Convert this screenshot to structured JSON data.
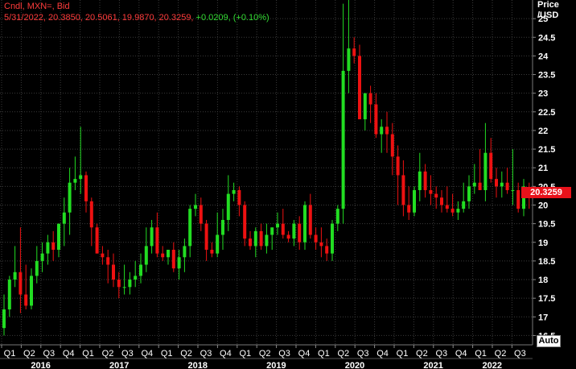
{
  "header": {
    "line1": "Cndl, MXN=, Bid",
    "line2_prefix": "5/31/2022, 20.3850, 20.5061, 19.9870, 20.3259, ",
    "line2_change": "+0.0209, (+0.10%)"
  },
  "axis": {
    "title_line1": "Price",
    "title_line2": "/USD",
    "auto_label": "Auto",
    "last_price": "20.3259"
  },
  "colors": {
    "up": "#22dd22",
    "down": "#ee1111",
    "background": "#000000",
    "grid": "#3a3a3a",
    "text": "#ffffff",
    "last_price_tag": "#e8121b"
  },
  "chart_data": {
    "type": "candlestick",
    "title": "Cndl, MXN=, Bid",
    "ylabel": "Price /USD",
    "ylim": [
      16.25,
      25.5
    ],
    "y_ticks": [
      "16.5",
      "17",
      "17.5",
      "18",
      "18.5",
      "19",
      "19.5",
      "20",
      "20.5",
      "21",
      "21.5",
      "22",
      "22.5",
      "23",
      "23.5",
      "24",
      "24.5",
      "25"
    ],
    "x_quarter_labels": [
      "Q1",
      "Q2",
      "Q3",
      "Q4",
      "Q1",
      "Q2",
      "Q3",
      "Q4",
      "Q1",
      "Q2",
      "Q3",
      "Q4",
      "Q1",
      "Q2",
      "Q3",
      "Q4",
      "Q1",
      "Q2",
      "Q3",
      "Q4",
      "Q1",
      "Q2",
      "Q3",
      "Q4",
      "Q1",
      "Q2",
      "Q3"
    ],
    "x_year_labels": [
      {
        "year": "2016",
        "quarter_index": 1.5
      },
      {
        "year": "2017",
        "quarter_index": 5.5
      },
      {
        "year": "2018",
        "quarter_index": 9.5
      },
      {
        "year": "2019",
        "quarter_index": 13.5
      },
      {
        "year": "2020",
        "quarter_index": 17.5
      },
      {
        "year": "2021",
        "quarter_index": 21.5
      },
      {
        "year": "2022",
        "quarter_index": 24.5
      }
    ],
    "series": {
      "name": "MXN= Bid (monthly OHLC)",
      "ohlc": [
        [
          16.7,
          17.6,
          16.5,
          17.2
        ],
        [
          17.2,
          18.1,
          17.0,
          18.0
        ],
        [
          18.0,
          18.9,
          17.8,
          18.2
        ],
        [
          18.2,
          19.4,
          17.1,
          17.6
        ],
        [
          17.6,
          18.4,
          17.2,
          17.3
        ],
        [
          17.3,
          18.3,
          17.2,
          18.1
        ],
        [
          18.1,
          18.9,
          17.9,
          18.5
        ],
        [
          18.5,
          19.0,
          18.2,
          18.7
        ],
        [
          18.7,
          19.2,
          18.4,
          19.0
        ],
        [
          19.0,
          19.3,
          18.5,
          18.8
        ],
        [
          18.8,
          19.5,
          18.6,
          19.5
        ],
        [
          19.5,
          20.2,
          18.9,
          19.8
        ],
        [
          19.8,
          21.0,
          19.2,
          20.6
        ],
        [
          20.6,
          21.3,
          20.4,
          20.7
        ],
        [
          20.7,
          22.1,
          20.3,
          20.8
        ],
        [
          20.8,
          20.9,
          19.8,
          20.1
        ],
        [
          20.1,
          20.2,
          18.9,
          19.4
        ],
        [
          19.4,
          19.5,
          18.7,
          18.7
        ],
        [
          18.7,
          18.9,
          18.4,
          18.6
        ],
        [
          18.6,
          18.8,
          17.9,
          18.4
        ],
        [
          18.4,
          18.7,
          17.8,
          18.0
        ],
        [
          18.0,
          18.2,
          17.5,
          17.8
        ],
        [
          17.8,
          18.4,
          17.6,
          17.8
        ],
        [
          17.8,
          18.2,
          17.6,
          18.0
        ],
        [
          18.0,
          18.5,
          17.8,
          18.1
        ],
        [
          18.1,
          18.7,
          17.9,
          18.4
        ],
        [
          18.4,
          19.4,
          18.2,
          18.9
        ],
        [
          18.9,
          19.6,
          18.7,
          19.4
        ],
        [
          19.4,
          19.8,
          18.6,
          18.7
        ],
        [
          18.7,
          18.9,
          18.5,
          18.6
        ],
        [
          18.6,
          18.8,
          18.4,
          18.8
        ],
        [
          18.8,
          19.0,
          18.2,
          18.3
        ],
        [
          18.3,
          18.8,
          18.0,
          18.6
        ],
        [
          18.6,
          19.1,
          18.2,
          18.9
        ],
        [
          18.9,
          20.0,
          18.6,
          19.9
        ],
        [
          19.9,
          20.3,
          19.7,
          20.0
        ],
        [
          20.0,
          20.2,
          19.3,
          19.5
        ],
        [
          19.5,
          19.6,
          18.5,
          18.8
        ],
        [
          18.8,
          19.0,
          18.6,
          18.7
        ],
        [
          18.7,
          19.8,
          18.6,
          19.2
        ],
        [
          19.2,
          19.9,
          18.8,
          19.6
        ],
        [
          19.6,
          20.8,
          19.3,
          20.3
        ],
        [
          20.3,
          20.6,
          20.1,
          20.4
        ],
        [
          20.4,
          20.5,
          19.7,
          20.0
        ],
        [
          20.0,
          20.1,
          18.9,
          19.1
        ],
        [
          19.1,
          19.3,
          18.8,
          18.9
        ],
        [
          18.9,
          19.4,
          18.6,
          19.3
        ],
        [
          19.3,
          19.5,
          18.8,
          18.9
        ],
        [
          18.9,
          19.5,
          18.7,
          19.2
        ],
        [
          19.2,
          19.4,
          18.8,
          19.4
        ],
        [
          19.4,
          19.8,
          19.2,
          19.5
        ],
        [
          19.5,
          19.9,
          19.1,
          19.2
        ],
        [
          19.2,
          19.3,
          19.0,
          19.1
        ],
        [
          19.1,
          19.6,
          18.9,
          19.5
        ],
        [
          19.5,
          19.7,
          18.8,
          19.0
        ],
        [
          19.0,
          20.1,
          18.8,
          20.0
        ],
        [
          20.0,
          20.3,
          19.1,
          19.2
        ],
        [
          19.2,
          19.4,
          18.8,
          19.0
        ],
        [
          19.0,
          19.4,
          18.6,
          18.9
        ],
        [
          18.9,
          19.1,
          18.5,
          18.7
        ],
        [
          18.7,
          19.6,
          18.5,
          19.5
        ],
        [
          19.5,
          20.0,
          19.3,
          19.9
        ],
        [
          19.9,
          25.4,
          19.5,
          23.6
        ],
        [
          23.6,
          25.8,
          23.0,
          24.2
        ],
        [
          24.2,
          24.5,
          23.8,
          24.0
        ],
        [
          24.0,
          24.3,
          22.6,
          22.3
        ],
        [
          22.3,
          23.0,
          22.0,
          23.0
        ],
        [
          23.0,
          23.2,
          22.2,
          22.7
        ],
        [
          22.7,
          23.0,
          21.8,
          21.9
        ],
        [
          21.9,
          22.3,
          21.4,
          22.1
        ],
        [
          22.1,
          22.5,
          21.4,
          21.9
        ],
        [
          21.9,
          22.2,
          20.8,
          21.3
        ],
        [
          21.3,
          21.6,
          20.0,
          20.8
        ],
        [
          20.8,
          21.2,
          19.7,
          20.0
        ],
        [
          20.0,
          20.5,
          19.6,
          19.8
        ],
        [
          19.8,
          20.5,
          19.7,
          20.4
        ],
        [
          20.4,
          21.4,
          20.1,
          20.9
        ],
        [
          20.9,
          21.1,
          20.2,
          20.4
        ],
        [
          20.4,
          20.8,
          20.0,
          20.3
        ],
        [
          20.3,
          20.5,
          19.9,
          20.2
        ],
        [
          20.2,
          20.4,
          19.8,
          20.0
        ],
        [
          20.0,
          20.5,
          19.8,
          19.9
        ],
        [
          19.9,
          20.3,
          19.7,
          19.8
        ],
        [
          19.8,
          20.1,
          19.6,
          19.9
        ],
        [
          19.9,
          20.6,
          19.8,
          20.1
        ],
        [
          20.1,
          20.8,
          19.9,
          20.5
        ],
        [
          20.5,
          21.1,
          20.3,
          20.6
        ],
        [
          20.6,
          21.5,
          20.4,
          20.4
        ],
        [
          20.4,
          22.2,
          20.1,
          21.4
        ],
        [
          21.4,
          21.8,
          20.6,
          20.7
        ],
        [
          20.7,
          21.0,
          20.2,
          20.5
        ],
        [
          20.5,
          20.9,
          20.2,
          20.6
        ],
        [
          20.6,
          21.0,
          20.3,
          20.4
        ],
        [
          20.4,
          21.5,
          20.0,
          20.4
        ],
        [
          20.4,
          20.6,
          19.8,
          19.9
        ],
        [
          19.9,
          20.7,
          19.7,
          20.5
        ],
        [
          20.4,
          20.6,
          19.9,
          20.3
        ]
      ]
    },
    "last": 20.3259
  }
}
